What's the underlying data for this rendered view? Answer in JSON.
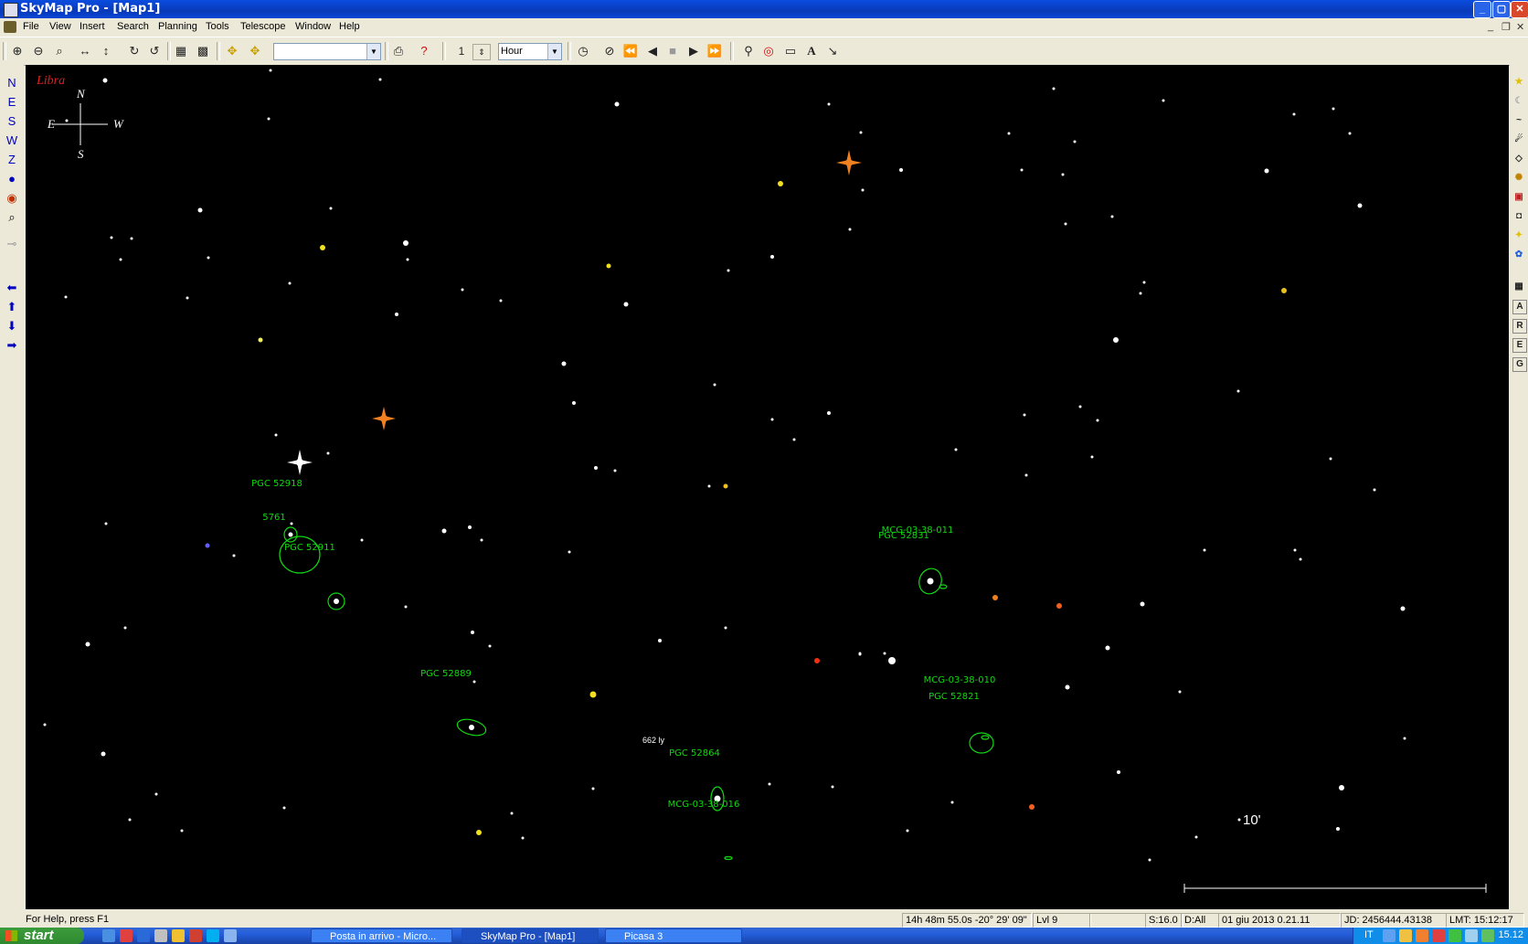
{
  "window": {
    "title": "SkyMap Pro - [Map1]",
    "controls": [
      "_",
      "▢",
      "✕"
    ]
  },
  "menu": [
    "File",
    "View",
    "Insert",
    "Search",
    "Planning",
    "Tools",
    "Telescope",
    "Window",
    "Help"
  ],
  "toolbar": {
    "step_value": "1",
    "time_unit": "Hour",
    "object_combo": ""
  },
  "left_buttons": [
    "N",
    "E",
    "S",
    "W",
    "Z"
  ],
  "right_buttons": [
    "A",
    "R",
    "E",
    "G"
  ],
  "map": {
    "constellation": "Libra",
    "compass": {
      "n": "N",
      "e": "E",
      "s": "S",
      "w": "W"
    },
    "scale_label": "10'",
    "distance_label": "662 ly",
    "objects": [
      {
        "label": "PGC 52918"
      },
      {
        "label": "5761"
      },
      {
        "label": "PGC 52911"
      },
      {
        "label": "PGC 52889"
      },
      {
        "label": "PGC 52864"
      },
      {
        "label": "MCG-03-38-016"
      },
      {
        "label": "MCG-03-38-011"
      },
      {
        "label": "PGC 52831"
      },
      {
        "label": "MCG-03-38-010"
      },
      {
        "label": "PGC 52821"
      }
    ]
  },
  "status": {
    "help": "For Help, press F1",
    "coords": "14h 48m 55.0s  -20° 29' 09\"",
    "level": "Lvl 9",
    "limit": "S:16.0",
    "display": "D:All",
    "date": "01 giu 2013 0.21.11",
    "jd": "JD: 2456444.43138",
    "lmt": "LMT: 15:12:17"
  },
  "taskbar": {
    "start": "start",
    "tasks": [
      {
        "label": "Posta in arrivo - Micro..."
      },
      {
        "label": "SkyMap Pro - [Map1]"
      },
      {
        "label": "Picasa 3"
      }
    ],
    "lang": "IT",
    "clock": "15.12"
  },
  "colors": {
    "map_bg": "#000000",
    "label_green": "#11d811",
    "title_blue": "#0a4de0"
  }
}
